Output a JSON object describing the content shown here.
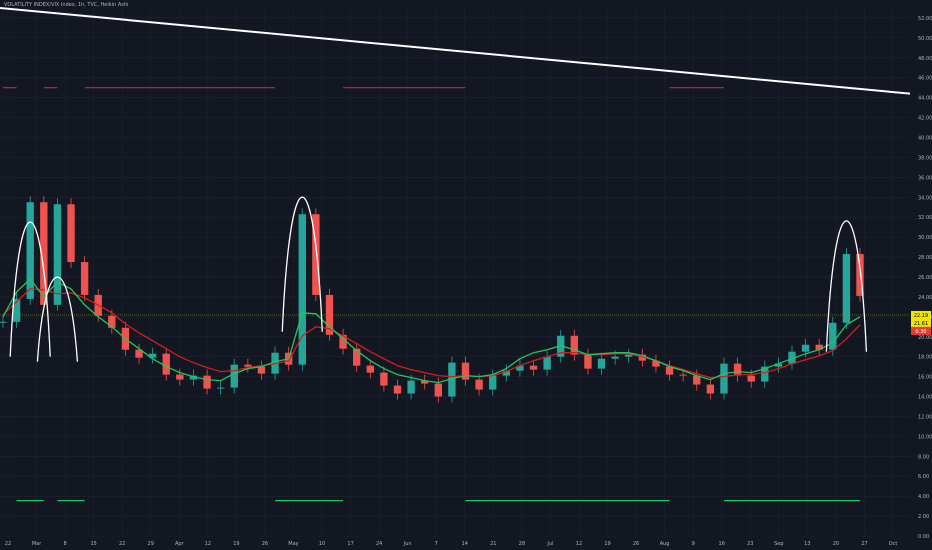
{
  "header": {
    "symbol_line": "VOLATILITY INDEX/VIX Index, 1h, TVC, Heikin Ashi"
  },
  "colors": {
    "background": "#131722",
    "grid": "#1f2433",
    "axis_text": "#b2b5be",
    "trend_line": "#ffffff",
    "arcs": "#ffffff",
    "ma_fast": "#22c55e",
    "ma_slow": "#d11f1f",
    "candle_up": "#26a69a",
    "candle_down": "#ef5350",
    "signal_green": "#22c55e",
    "signal_red": "#c62828",
    "current_line": "#7a8a2a",
    "price_tag_bg": "#f2e600",
    "price_tag_red": "#e53935"
  },
  "chart_data": {
    "type": "line",
    "title": "",
    "xlabel": "",
    "ylabel": "",
    "x_ticks": [
      "22",
      "Mar",
      "8",
      "15",
      "22",
      "29",
      "Apr",
      "12",
      "19",
      "26",
      "May",
      "10",
      "17",
      "24",
      "Jun",
      "7",
      "14",
      "21",
      "28",
      "Jul",
      "12",
      "19",
      "26",
      "Aug",
      "9",
      "16",
      "23",
      "Sep",
      "13",
      "20",
      "27",
      "Oct"
    ],
    "y_ticks": [
      "52.00",
      "50.00",
      "48.00",
      "46.00",
      "44.00",
      "42.00",
      "40.00",
      "38.00",
      "36.00",
      "34.00",
      "32.00",
      "30.00",
      "28.00",
      "26.00",
      "24.00",
      "22.00",
      "20.00",
      "18.00",
      "16.00",
      "14.00",
      "12.00",
      "10.00",
      "8.00",
      "6.00",
      "4.00",
      "2.00",
      "0.00"
    ],
    "ylim": [
      0,
      53
    ],
    "price_labels": {
      "current": "22.19",
      "secondary": "21.61",
      "change": "0.30"
    },
    "series": [
      {
        "values": [
          21.5,
          23.8,
          33.5,
          23.2,
          33.3,
          27.5,
          24.2,
          22.1,
          20.9,
          18.7,
          17.9,
          18.3,
          16.2,
          15.7,
          16.1,
          14.8,
          14.9,
          17.2,
          17.0,
          16.3,
          18.4,
          17.2,
          32.3,
          24.2,
          20.2,
          18.8,
          17.1,
          16.4,
          15.1,
          14.3,
          15.6,
          15.3,
          14.0,
          17.4,
          15.7,
          14.7,
          16.1,
          16.6,
          17.1,
          16.7,
          18.0,
          20.1,
          18.2,
          16.8,
          17.8,
          18.0,
          18.2,
          17.6,
          17.0,
          16.2,
          16.1,
          15.2,
          14.3,
          17.3,
          16.1,
          15.5,
          17.0,
          17.3,
          18.5,
          19.2,
          18.7,
          21.4,
          28.3,
          24.1
        ]
      },
      {
        "values": [
          22.0,
          24.5,
          25.8,
          24.0,
          25.5,
          24.8,
          23.2,
          22.0,
          21.0,
          19.8,
          18.8,
          17.8,
          17.0,
          16.4,
          16.0,
          15.7,
          15.6,
          16.3,
          16.8,
          17.0,
          17.5,
          17.8,
          22.4,
          22.3,
          21.0,
          19.8,
          18.6,
          17.6,
          16.8,
          16.2,
          15.9,
          15.6,
          15.4,
          15.8,
          16.1,
          16.0,
          16.2,
          16.8,
          17.8,
          18.4,
          18.7,
          19.1,
          18.7,
          18.2,
          18.3,
          18.4,
          18.4,
          18.1,
          17.6,
          17.0,
          16.6,
          16.1,
          15.7,
          16.3,
          16.5,
          16.4,
          16.8,
          17.3,
          17.8,
          18.3,
          18.7,
          19.4,
          21.2,
          22.0
        ]
      },
      {
        "values": [
          22.2,
          23.5,
          24.8,
          24.7,
          24.3,
          24.4,
          23.9,
          23.2,
          22.4,
          21.3,
          20.4,
          19.6,
          18.8,
          18.0,
          17.4,
          16.9,
          16.5,
          16.6,
          16.9,
          17.1,
          17.3,
          17.6,
          20.1,
          21.0,
          20.8,
          20.1,
          19.3,
          18.5,
          17.8,
          17.1,
          16.7,
          16.4,
          16.1,
          16.0,
          16.1,
          16.0,
          16.1,
          16.5,
          17.1,
          17.6,
          18.0,
          18.4,
          18.4,
          18.2,
          18.2,
          18.3,
          18.3,
          18.0,
          17.6,
          17.1,
          16.7,
          16.3,
          15.9,
          16.0,
          16.2,
          16.2,
          16.4,
          16.8,
          17.3,
          17.7,
          18.1,
          18.6,
          19.8,
          21.2
        ]
      }
    ],
    "trend_line": {
      "start": [
        0,
        53.0
      ],
      "end": [
        1,
        44.4
      ]
    },
    "arcs": [
      {
        "base": 18.0,
        "peak": 33.0
      },
      {
        "base": 17.5,
        "peak": 25.8
      },
      {
        "base": 20.5,
        "peak": 35.5
      },
      {
        "base": 18.5,
        "peak": 33.0
      },
      {
        "base": 20.5,
        "peak": 35.0
      }
    ],
    "red_signal_level": 45.0,
    "green_signal_level": 3.55
  }
}
